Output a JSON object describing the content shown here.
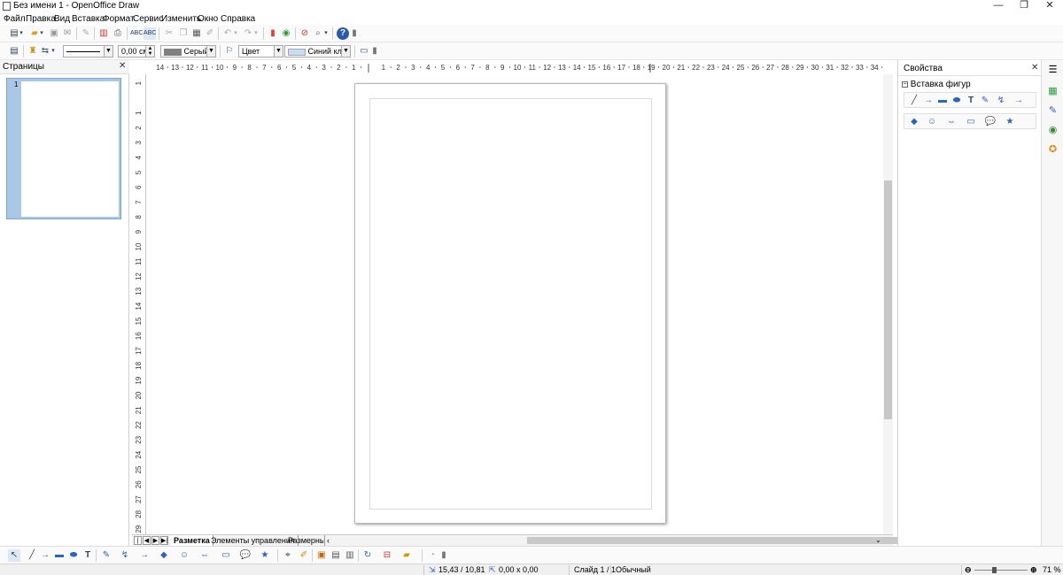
{
  "window": {
    "title": "Без имени 1 - OpenOffice Draw",
    "minimize": "—",
    "restore": "❐",
    "close": "✕"
  },
  "menu": [
    {
      "label": "Файл"
    },
    {
      "label": "Правка"
    },
    {
      "label": "Вид"
    },
    {
      "label": "Вставка"
    },
    {
      "label": "Формат"
    },
    {
      "label": "Сервис"
    },
    {
      "label": "Изменить"
    },
    {
      "label": "Окно"
    },
    {
      "label": "Справка"
    }
  ],
  "linebar": {
    "line_style": "",
    "line_width": "0,00 см",
    "line_color": "Серый",
    "line_color_hex": "#808080",
    "area_style": "Цвет",
    "area_color": "Синий кла",
    "area_color_hex": "#c9dcf2"
  },
  "pages_panel": {
    "title": "Страницы",
    "close": "✕",
    "page_number": "1"
  },
  "ruler": {
    "h_ticks": [
      "14",
      "13",
      "12",
      "11",
      "10",
      "9",
      "8",
      "7",
      "6",
      "5",
      "4",
      "3",
      "2",
      "1",
      "1",
      "2",
      "3",
      "4",
      "5",
      "6",
      "7",
      "8",
      "9",
      "10",
      "11",
      "12",
      "13",
      "14",
      "15",
      "16",
      "17",
      "18",
      "19",
      "20",
      "21",
      "22",
      "23",
      "24",
      "25",
      "26",
      "27",
      "28",
      "29",
      "30",
      "31",
      "32",
      "33",
      "34"
    ],
    "v_ticks": [
      "1",
      "1",
      "2",
      "3",
      "4",
      "5",
      "6",
      "7",
      "8",
      "9",
      "10",
      "11",
      "12",
      "13",
      "14",
      "15",
      "16",
      "17",
      "18",
      "19",
      "20",
      "21",
      "22",
      "23",
      "24",
      "25",
      "26",
      "27",
      "28",
      "29"
    ]
  },
  "layer_tabs": [
    {
      "label": "Разметка"
    },
    {
      "label": "Элементы управления"
    },
    {
      "label": "Размерные"
    }
  ],
  "properties": {
    "title": "Свойства",
    "close": "✕",
    "section": "Вставка фигур"
  },
  "status": {
    "position": "15,43 / 10,81",
    "size": "0,00 x 0,00",
    "slide": "Слайд 1 / 1",
    "layout": "Обычный",
    "zoom": "71 %",
    "zoom_level": 0.71
  }
}
